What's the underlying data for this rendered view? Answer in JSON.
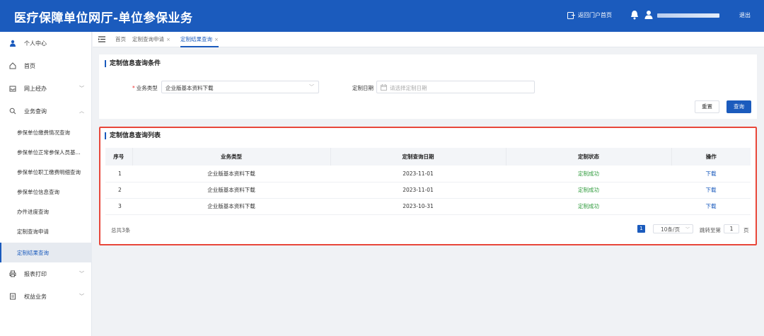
{
  "header": {
    "title": "医疗保障单位网厅-单位参保业务",
    "portal_label": "返回门户首页",
    "logout_label": "退出"
  },
  "sidebar": {
    "personal": "个人中心",
    "home": "首页",
    "online": "网上经办",
    "business": "业务查询",
    "sub_items": [
      "参保单位缴费情况查询",
      "参保单位正常参保人员基...",
      "参保单位职工缴费明细查询",
      "参保单位信息查询",
      "办件进度查询",
      "定制查询申请",
      "定制结果查询"
    ],
    "report": "报表打印",
    "rights": "权益业务"
  },
  "tabs": {
    "home": "首页",
    "apply": "定制查询申请",
    "result": "定制结果查询",
    "close": "×"
  },
  "filter": {
    "title": "定制信息查询条件",
    "business_type_label": "业务类型",
    "business_type_value": "企业版基本资料下载",
    "date_label": "定制日期",
    "date_placeholder": "请选择定制日期",
    "reset_label": "重置",
    "query_label": "查询"
  },
  "list": {
    "title": "定制信息查询列表",
    "columns": [
      "序号",
      "业务类型",
      "定制查询日期",
      "定制状态",
      "操作"
    ],
    "rows": [
      {
        "no": "1",
        "type": "企业版基本资料下载",
        "date": "2023-11-01",
        "status": "定制成功",
        "action": "下载"
      },
      {
        "no": "2",
        "type": "企业版基本资料下载",
        "date": "2023-11-01",
        "status": "定制成功",
        "action": "下载"
      },
      {
        "no": "3",
        "type": "企业版基本资料下载",
        "date": "2023-10-31",
        "status": "定制成功",
        "action": "下载"
      }
    ],
    "total": "总共3条",
    "page": "1",
    "page_size": "10条/页",
    "jump_label": "跳转至第",
    "jump_value": "1",
    "jump_unit": "页"
  },
  "colors": {
    "brand": "#1b5bbd",
    "success": "#2f9b3c",
    "highlight": "#e8473a"
  }
}
